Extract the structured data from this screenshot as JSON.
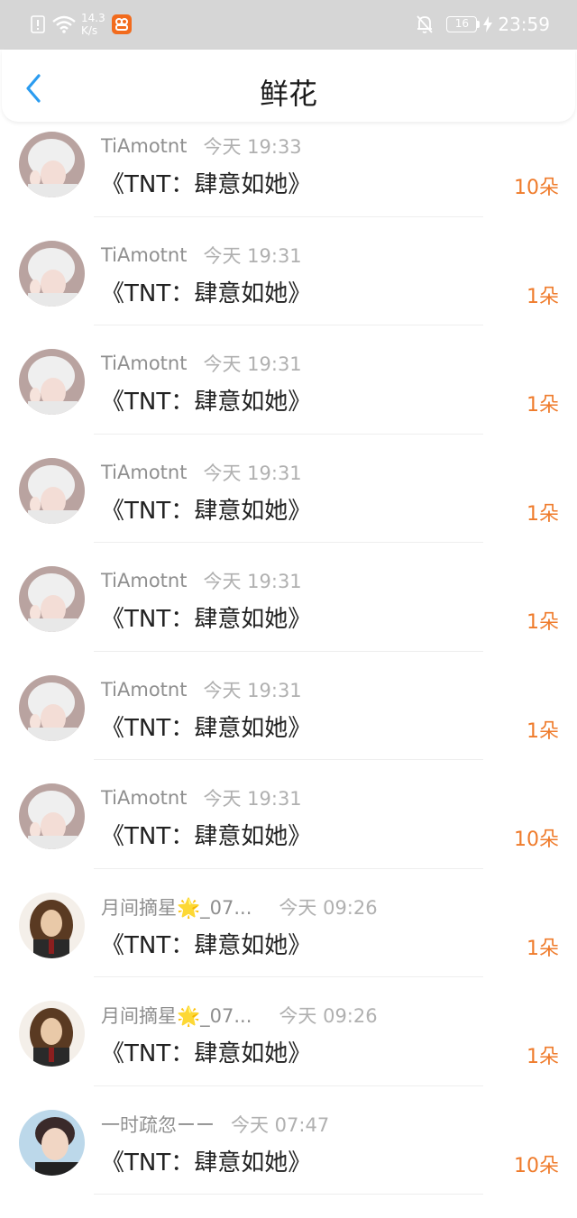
{
  "status_bar": {
    "net_speed_value": "14.3",
    "net_speed_unit": "K/s",
    "battery": "16",
    "time": "23:59",
    "icons": [
      "alert-icon",
      "wifi-icon",
      "app-badge-icon",
      "mute-bell-icon",
      "battery-icon",
      "charging-icon"
    ]
  },
  "nav": {
    "title": "鲜花",
    "back_icon": "chevron-left-icon"
  },
  "colors": {
    "accent_blue": "#2b9cf0",
    "count_orange": "#ef7b2b",
    "status_bar_bg": "#d6d6d6"
  },
  "items": [
    {
      "name": "TiAmotnt",
      "time": "今天 19:33",
      "title": "《TNT：肆意如她》",
      "count": "10朵"
    },
    {
      "name": "TiAmotnt",
      "time": "今天 19:31",
      "title": "《TNT：肆意如她》",
      "count": "1朵"
    },
    {
      "name": "TiAmotnt",
      "time": "今天 19:31",
      "title": "《TNT：肆意如她》",
      "count": "1朵"
    },
    {
      "name": "TiAmotnt",
      "time": "今天 19:31",
      "title": "《TNT：肆意如她》",
      "count": "1朵"
    },
    {
      "name": "TiAmotnt",
      "time": "今天 19:31",
      "title": "《TNT：肆意如她》",
      "count": "1朵"
    },
    {
      "name": "TiAmotnt",
      "time": "今天 19:31",
      "title": "《TNT：肆意如她》",
      "count": "1朵"
    },
    {
      "name": "TiAmotnt",
      "time": "今天 19:31",
      "title": "《TNT：肆意如她》",
      "count": "10朵"
    },
    {
      "name": "月间摘星🌟_07...",
      "time": "今天 09:26",
      "title": "《TNT：肆意如她》",
      "count": "1朵"
    },
    {
      "name": "月间摘星🌟_07...",
      "time": "今天 09:26",
      "title": "《TNT：肆意如她》",
      "count": "1朵"
    },
    {
      "name": "一时疏忽ーー",
      "time": "今天 07:47",
      "title": "《TNT：肆意如她》",
      "count": "10朵"
    }
  ]
}
